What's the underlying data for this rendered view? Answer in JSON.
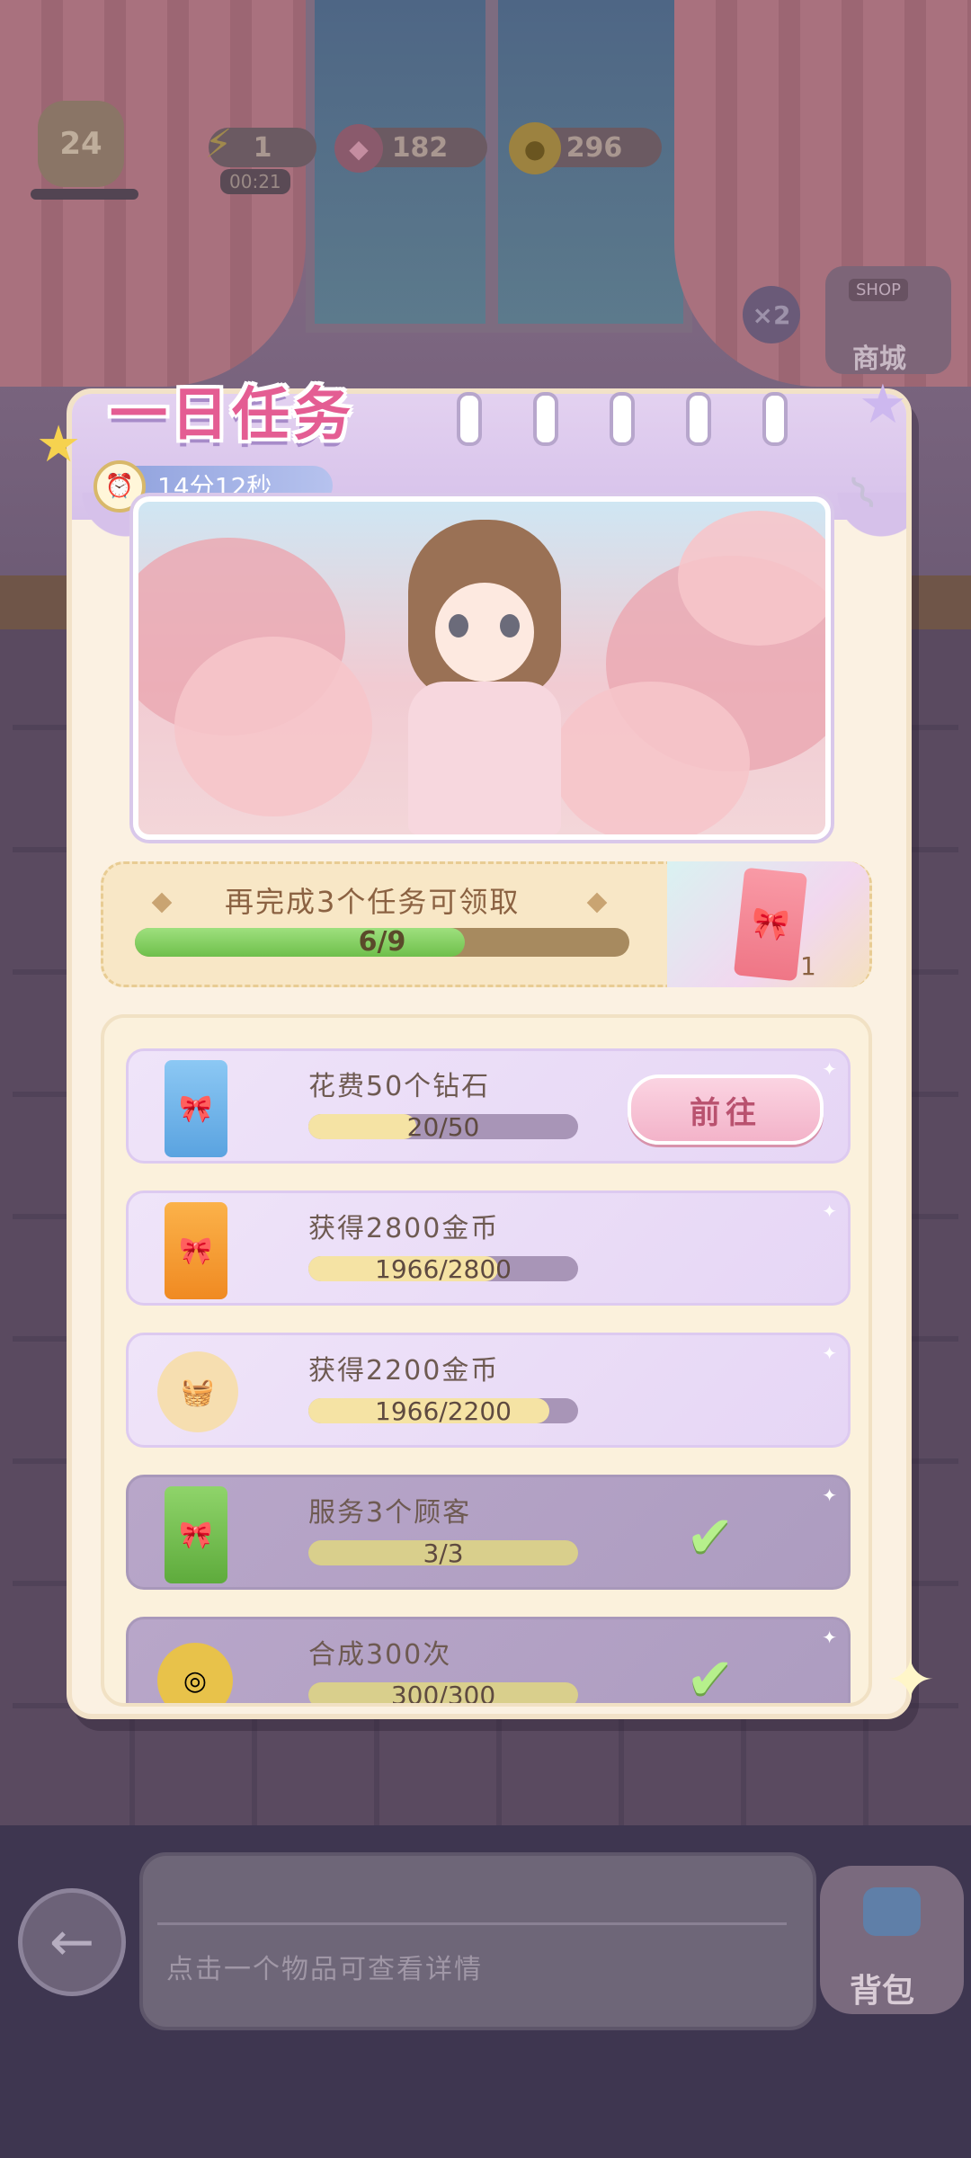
{
  "hud": {
    "level": "24",
    "energy": "1",
    "energy_timer": "00:21",
    "gems": "182",
    "coins": "296",
    "multiplier": "×2",
    "shop_badge": "SHOP",
    "shop_label": "商城"
  },
  "modal": {
    "title": "一日任务",
    "timer": "14分12秒",
    "reward": {
      "text": "再完成3个任务可领取",
      "progress_label": "6/9",
      "progress": 0.667,
      "item_count": "1"
    },
    "tasks": [
      {
        "name": "花费50个钻石",
        "progress_label": "20/50",
        "progress": 0.4,
        "action": "前往",
        "icon": "blue-card-pack-icon",
        "done": false
      },
      {
        "name": "获得2800金币",
        "progress_label": "1966/2800",
        "progress": 0.702,
        "icon": "orange-card-pack-icon",
        "done": false
      },
      {
        "name": "获得2200金币",
        "progress_label": "1966/2200",
        "progress": 0.894,
        "icon": "food-basket-icon",
        "done": false
      },
      {
        "name": "服务3个顾客",
        "progress_label": "3/3",
        "progress": 1.0,
        "icon": "green-card-pack-icon",
        "done": true
      },
      {
        "name": "合成300次",
        "progress_label": "300/300",
        "progress": 1.0,
        "icon": "gold-coins-icon",
        "done": true
      }
    ]
  },
  "bottom": {
    "hint": "点击一个物品可查看详情",
    "bag_label": "背包"
  },
  "colors": {
    "title_pink": "#e45d93",
    "progress_green": "#6fbf4b",
    "task_purple": "#e6d6f5",
    "go_button": "#f3b3c9"
  }
}
